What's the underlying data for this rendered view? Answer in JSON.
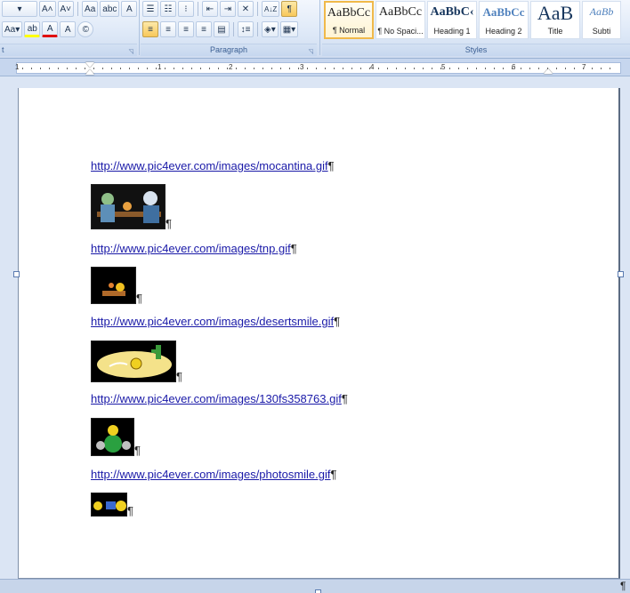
{
  "ribbon": {
    "font_row1": [
      "A˄",
      "A˅",
      "Aa",
      "abc",
      "A"
    ],
    "font_row2": [
      "Aa",
      "ab",
      "A",
      "A",
      "©"
    ],
    "para_row2_pilcrow": "¶",
    "sort_icon": "A↓Z",
    "paragraph_label": "Paragraph",
    "styles_label": "Styles",
    "font_group_label_fragment": "t",
    "styles": [
      {
        "sample": "AaBbCc",
        "name": "¶ Normal",
        "active": true
      },
      {
        "sample": "AaBbCc",
        "name": "¶ No Spaci...",
        "active": false
      },
      {
        "sample": "AaBbC‹",
        "name": "Heading 1",
        "active": false
      },
      {
        "sample": "AaBbCc",
        "name": "Heading 2",
        "active": false
      },
      {
        "sample": "AaB",
        "name": "Title",
        "active": false
      },
      {
        "sample": "AaBb",
        "name": "Subti",
        "active": false
      }
    ]
  },
  "ruler": {
    "numbers": [
      "1",
      "1",
      "2",
      "3",
      "4",
      "5",
      "6",
      "7"
    ]
  },
  "document": {
    "links": [
      "http://www.pic4ever.com/images/mocantina.gif",
      "http://www.pic4ever.com/images/tnp.gif",
      "http://www.pic4ever.com/images/desertsmile.gif",
      "http://www.pic4ever.com/images/130fs358763.gif",
      "http://www.pic4ever.com/images/photosmile.gif"
    ],
    "pilcrow": "¶"
  },
  "colors": {
    "link": "#1a1aa8",
    "active_style": "#f0b94a",
    "ribbon_bg": "#dde8f7"
  }
}
